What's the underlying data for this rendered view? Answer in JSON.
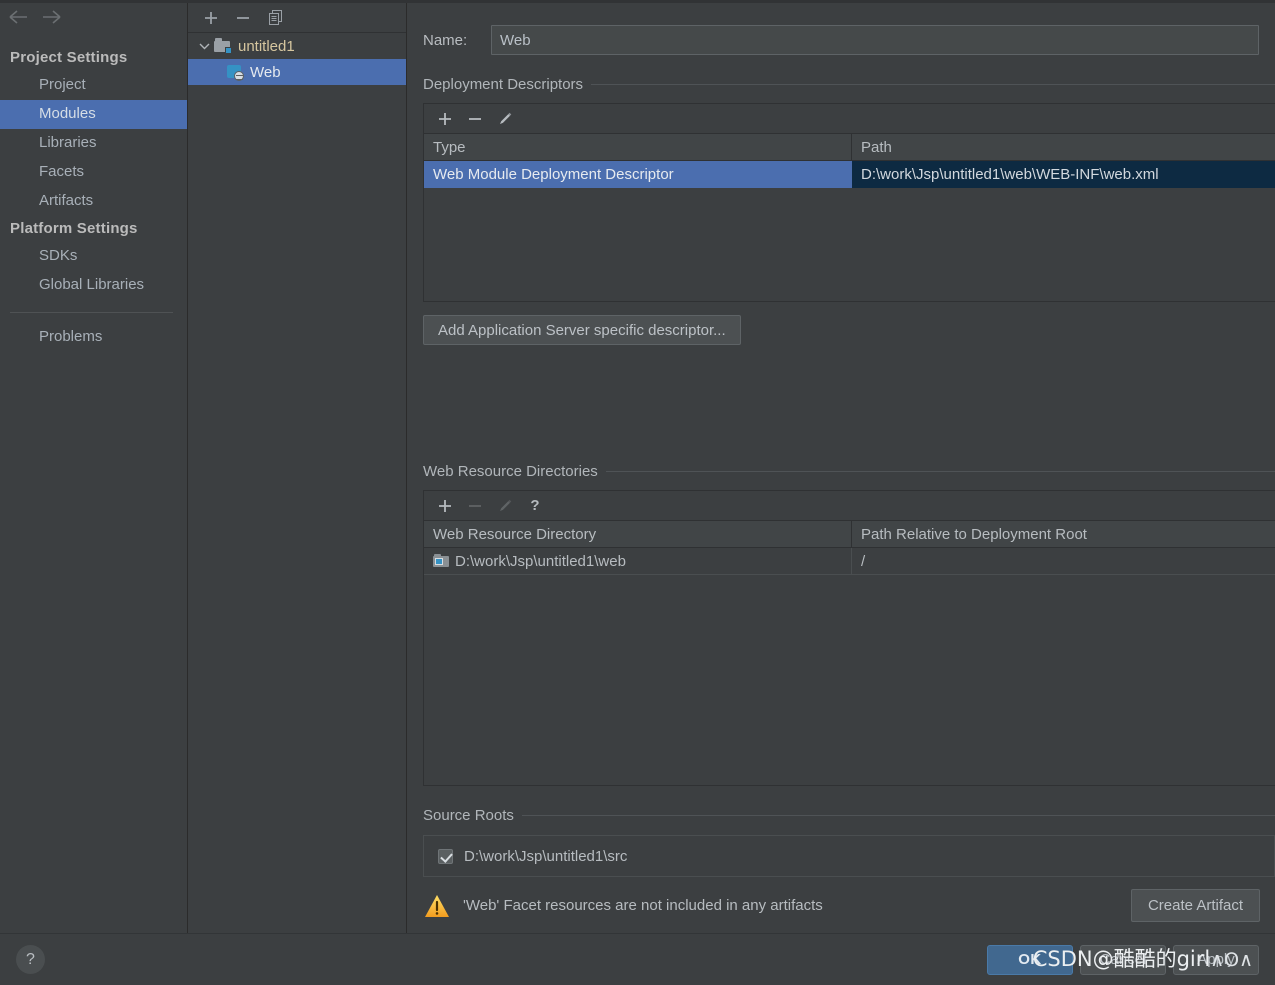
{
  "sidebar": {
    "nav": {
      "back_icon": "arrow-left-icon",
      "forward_icon": "arrow-right-icon"
    },
    "groups": [
      {
        "title": "Project Settings",
        "items": [
          {
            "label": "Project",
            "selected": false
          },
          {
            "label": "Modules",
            "selected": true
          },
          {
            "label": "Libraries",
            "selected": false
          },
          {
            "label": "Facets",
            "selected": false
          },
          {
            "label": "Artifacts",
            "selected": false
          }
        ]
      },
      {
        "title": "Platform Settings",
        "items": [
          {
            "label": "SDKs",
            "selected": false
          },
          {
            "label": "Global Libraries",
            "selected": false
          }
        ]
      }
    ],
    "problems_label": "Problems"
  },
  "tree": {
    "toolbar": [
      {
        "icon": "plus-icon",
        "label": "Add"
      },
      {
        "icon": "minus-icon",
        "label": "Remove"
      },
      {
        "icon": "copy-icon",
        "label": "Copy"
      }
    ],
    "nodes": [
      {
        "label": "untitled1",
        "icon": "module-folder-icon",
        "selected": false,
        "expanded": true
      },
      {
        "label": "Web",
        "icon": "web-facet-icon",
        "selected": true,
        "child": true
      }
    ]
  },
  "main": {
    "name": {
      "label": "Name:",
      "value": "Web"
    },
    "deployment_descriptors": {
      "title": "Deployment Descriptors",
      "toolbar": [
        {
          "icon": "plus-icon",
          "enabled": true
        },
        {
          "icon": "minus-icon",
          "enabled": true
        },
        {
          "icon": "pencil-icon",
          "enabled": true
        }
      ],
      "columns": [
        "Type",
        "Path"
      ],
      "rows": [
        {
          "type": "Web Module Deployment Descriptor",
          "path": "D:\\work\\Jsp\\untitled1\\web\\WEB-INF\\web.xml",
          "selected": true
        }
      ],
      "add_server_descriptor_button": "Add Application Server specific descriptor..."
    },
    "web_resource_directories": {
      "title": "Web Resource Directories",
      "toolbar": [
        {
          "icon": "plus-icon",
          "enabled": true
        },
        {
          "icon": "minus-icon",
          "enabled": false
        },
        {
          "icon": "pencil-icon",
          "enabled": false
        },
        {
          "icon": "help-icon",
          "enabled": true
        }
      ],
      "columns": [
        "Web Resource Directory",
        "Path Relative to Deployment Root"
      ],
      "rows": [
        {
          "directory": "D:\\work\\Jsp\\untitled1\\web",
          "relative_path": "/",
          "icon": "web-directory-icon"
        }
      ]
    },
    "source_roots": {
      "title": "Source Roots",
      "rows": [
        {
          "path": "D:\\work\\Jsp\\untitled1\\src",
          "checked": true
        }
      ]
    },
    "warning": {
      "icon": "warning-triangle-icon",
      "text": "'Web' Facet resources are not included in any artifacts",
      "action_button": "Create Artifact"
    }
  },
  "bottom_bar": {
    "help_icon": "question-mark-icon",
    "buttons": [
      {
        "label": "OK",
        "primary": true
      },
      {
        "label": "Cancel",
        "primary": false
      },
      {
        "label": "Apply",
        "primary": false
      }
    ],
    "watermark": "CSDN@酷酷的girl",
    "watermark_tail": "∧O∧"
  },
  "colors": {
    "background": "#3c3f41",
    "selection_blue": "#4b6eaf",
    "path_cell_navy": "#0d2a42",
    "accent_icon_blue": "#3592c4",
    "warning_yellow": "#f5c542"
  }
}
